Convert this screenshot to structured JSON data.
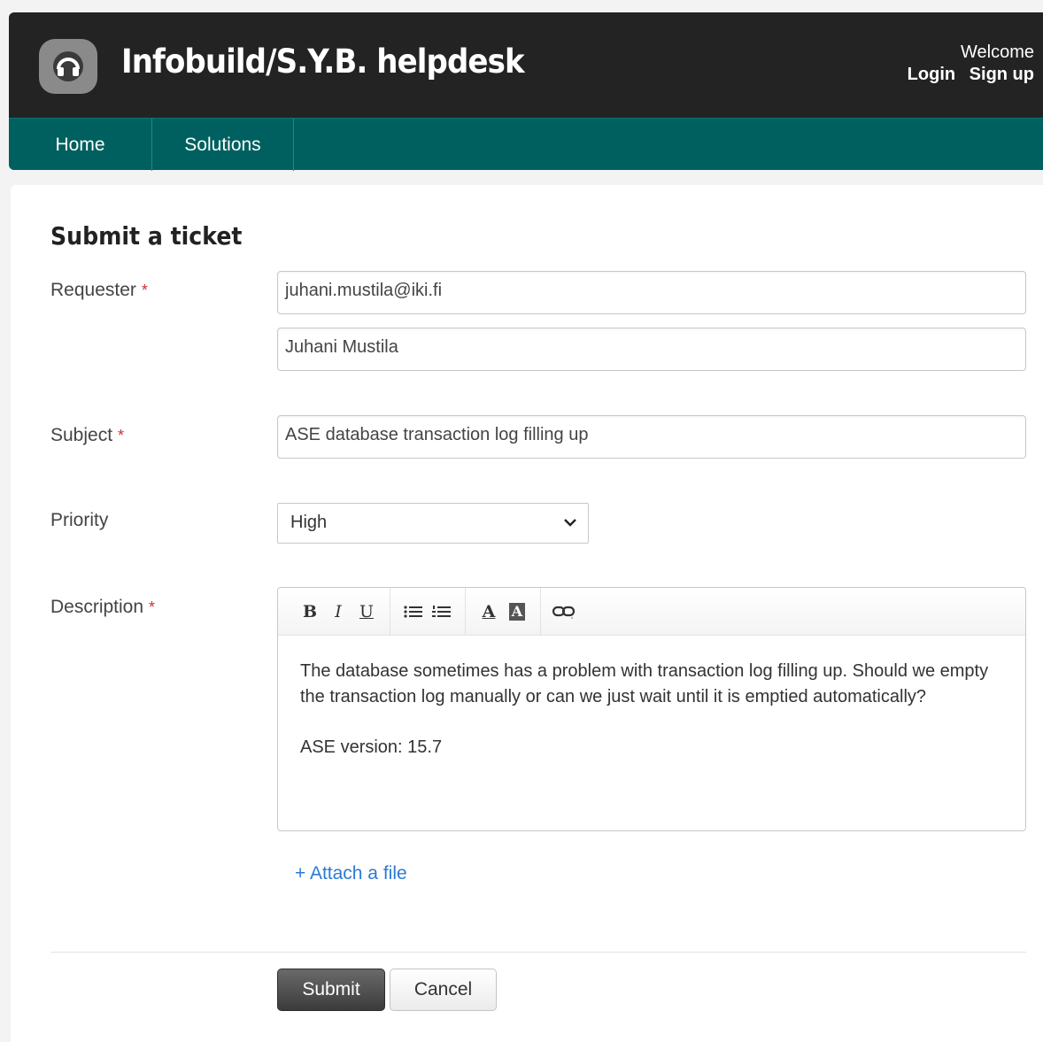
{
  "header": {
    "app_title": "Infobuild/S.Y.B. helpdesk",
    "welcome": "Welcome",
    "login": "Login",
    "signup": "Sign up",
    "logo_icon": "headset-icon"
  },
  "nav": {
    "items": [
      {
        "label": "Home"
      },
      {
        "label": "Solutions"
      }
    ]
  },
  "form": {
    "title": "Submit a ticket",
    "required_marker": "*",
    "requester": {
      "label": "Requester",
      "email": "juhani.mustila@iki.fi",
      "name": "Juhani Mustila"
    },
    "subject": {
      "label": "Subject",
      "value": "ASE database transaction log filling up"
    },
    "priority": {
      "label": "Priority",
      "selected": "High"
    },
    "description": {
      "label": "Description",
      "paragraph1": "The database sometimes has a problem with transaction log filling up. Should we empty the transaction log manually or can we just wait until it is emptied automatically?",
      "paragraph2": "ASE version: 15.7"
    },
    "toolbar": {
      "bold": "B",
      "italic": "I",
      "underline": "U",
      "font_color": "A",
      "bg_color": "A"
    },
    "attach_label": "+ Attach a file",
    "submit_label": "Submit",
    "cancel_label": "Cancel"
  },
  "colors": {
    "header_bg": "#232323",
    "nav_bg": "#00605f",
    "link": "#2b7bd3",
    "required": "#d0312d"
  }
}
